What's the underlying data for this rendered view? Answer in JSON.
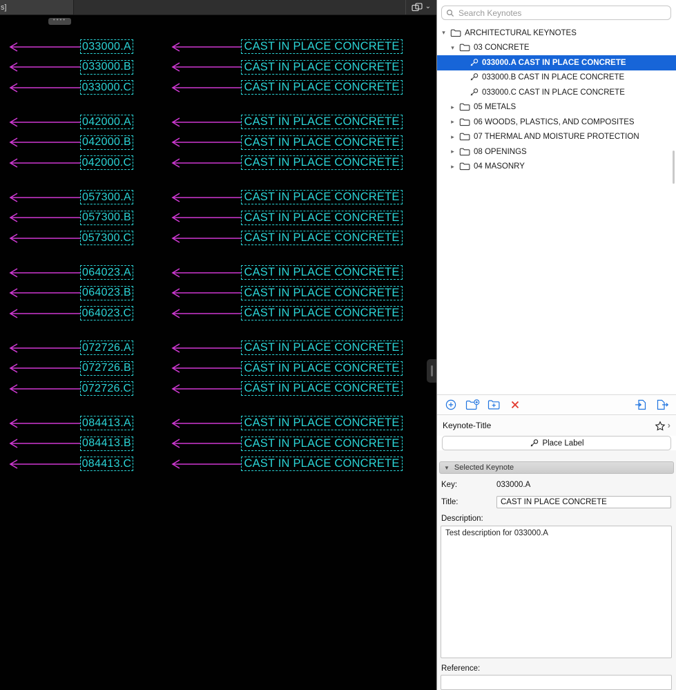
{
  "colors": {
    "leader_magenta": "#cf39d3",
    "keynote_cyan": "#2bd4d6",
    "selection_blue": "#1765d8",
    "accent_blue": "#1f74e0",
    "delete_red": "#e23a2e"
  },
  "topbar": {
    "tab_label": "s]"
  },
  "icons": {
    "dots_handle": "••••",
    "chevron_down": "⌄",
    "chevron_right": "›",
    "disclosure_expanded": "▾",
    "disclosure_collapsed": "▸",
    "section_triangle": "▼"
  },
  "canvas": {
    "groups": [
      {
        "keys": [
          "033000.A",
          "033000.B",
          "033000.C"
        ],
        "title": "CAST IN PLACE CONCRETE"
      },
      {
        "keys": [
          "042000.A",
          "042000.B",
          "042000.C"
        ],
        "title": "CAST IN PLACE CONCRETE"
      },
      {
        "keys": [
          "057300.A",
          "057300.B",
          "057300.C"
        ],
        "title": "CAST IN PLACE CONCRETE"
      },
      {
        "keys": [
          "064023.A",
          "064023.B",
          "064023.C"
        ],
        "title": "CAST IN PLACE CONCRETE"
      },
      {
        "keys": [
          "072726.A",
          "072726.B",
          "072726.C"
        ],
        "title": "CAST IN PLACE CONCRETE"
      },
      {
        "keys": [
          "084413.A",
          "084413.B",
          "084413.C"
        ],
        "title": "CAST IN PLACE CONCRETE"
      }
    ]
  },
  "sidebar": {
    "search": {
      "placeholder": "Search Keynotes"
    },
    "tree": [
      {
        "type": "folder",
        "label": "ARCHITECTURAL KEYNOTES",
        "level": 0,
        "expanded": true
      },
      {
        "type": "folder",
        "label": "03 CONCRETE",
        "level": 1,
        "expanded": true
      },
      {
        "type": "keynote",
        "label": "033000.A CAST IN PLACE CONCRETE",
        "level": 2,
        "selected": true
      },
      {
        "type": "keynote",
        "label": "033000.B CAST IN PLACE CONCRETE",
        "level": 2
      },
      {
        "type": "keynote",
        "label": "033000.C CAST IN PLACE CONCRETE",
        "level": 2
      },
      {
        "type": "folder",
        "label": "05 METALS",
        "level": 1,
        "expanded": false
      },
      {
        "type": "folder",
        "label": "06 WOODS, PLASTICS, AND COMPOSITES",
        "level": 1,
        "expanded": false
      },
      {
        "type": "folder",
        "label": "07 THERMAL AND MOISTURE PROTECTION",
        "level": 1,
        "expanded": false
      },
      {
        "type": "folder",
        "label": "08 OPENINGS",
        "level": 1,
        "expanded": false
      },
      {
        "type": "folder",
        "label": "04 MASONRY",
        "level": 1,
        "expanded": false
      }
    ],
    "keynote_title_label": "Keynote-Title",
    "place_label_button": "Place Label",
    "selected": {
      "header": "Selected Keynote",
      "key_label": "Key:",
      "key_value": "033000.A",
      "title_label": "Title:",
      "title_value": "CAST IN PLACE CONCRETE",
      "description_label": "Description:",
      "description_value": "Test description for 033000.A",
      "reference_label": "Reference:"
    }
  }
}
